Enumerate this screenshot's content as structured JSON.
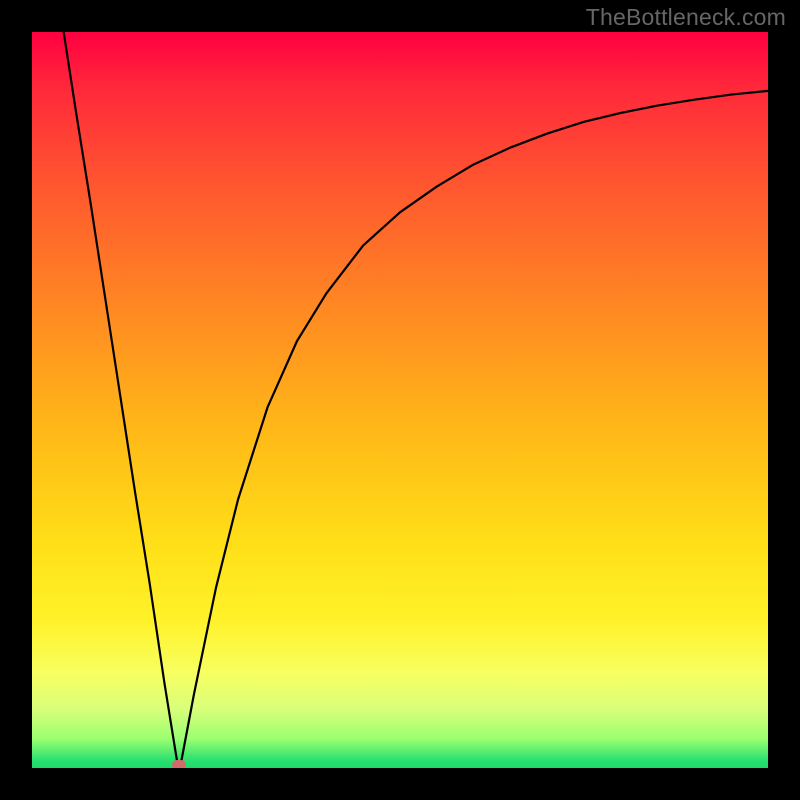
{
  "watermark": "TheBottleneck.com",
  "chart_data": {
    "type": "line",
    "title": "",
    "xlabel": "",
    "ylabel": "",
    "x_range": [
      0,
      100
    ],
    "y_range": [
      0,
      100
    ],
    "grid": false,
    "legend": false,
    "background": "rainbow-gradient (red top → green bottom)",
    "marker": {
      "x": 20,
      "y": 0,
      "color": "#d36a6a"
    },
    "curve": [
      {
        "x": 4.3,
        "y": 100.0
      },
      {
        "x": 6.0,
        "y": 89.0
      },
      {
        "x": 8.0,
        "y": 76.5
      },
      {
        "x": 10.0,
        "y": 63.5
      },
      {
        "x": 12.0,
        "y": 50.5
      },
      {
        "x": 14.0,
        "y": 37.5
      },
      {
        "x": 16.0,
        "y": 25.0
      },
      {
        "x": 18.0,
        "y": 11.5
      },
      {
        "x": 19.7,
        "y": 1.0
      },
      {
        "x": 20.0,
        "y": 0.0
      },
      {
        "x": 20.3,
        "y": 1.0
      },
      {
        "x": 22.0,
        "y": 10.0
      },
      {
        "x": 25.0,
        "y": 24.5
      },
      {
        "x": 28.0,
        "y": 36.5
      },
      {
        "x": 32.0,
        "y": 49.0
      },
      {
        "x": 36.0,
        "y": 58.0
      },
      {
        "x": 40.0,
        "y": 64.5
      },
      {
        "x": 45.0,
        "y": 71.0
      },
      {
        "x": 50.0,
        "y": 75.5
      },
      {
        "x": 55.0,
        "y": 79.0
      },
      {
        "x": 60.0,
        "y": 82.0
      },
      {
        "x": 65.0,
        "y": 84.3
      },
      {
        "x": 70.0,
        "y": 86.2
      },
      {
        "x": 75.0,
        "y": 87.8
      },
      {
        "x": 80.0,
        "y": 89.0
      },
      {
        "x": 85.0,
        "y": 90.0
      },
      {
        "x": 90.0,
        "y": 90.8
      },
      {
        "x": 95.0,
        "y": 91.5
      },
      {
        "x": 100.0,
        "y": 92.0
      }
    ]
  }
}
